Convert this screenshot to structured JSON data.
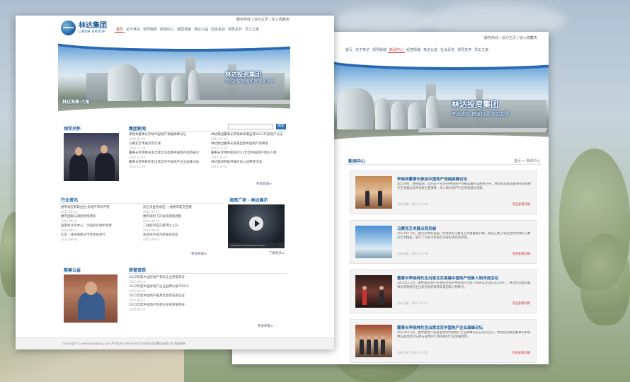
{
  "front": {
    "top_links": "服务热线 | 设为主页 | 加入收藏夹",
    "logo": {
      "cn": "林达集团",
      "en": "LINDA GROUP"
    },
    "nav": [
      "首页",
      "关于林达",
      "领导致辞",
      "新闻中心",
      "经营领域",
      "林达公益",
      "社会责任",
      "领导关怀",
      "员工之家"
    ],
    "banner": {
      "slogan": "林达投资集团",
      "sub": "开拓进取 把握机遇 领跑世界",
      "tag": "林达海景·六角"
    },
    "leader": {
      "title": "领导关怀"
    },
    "news": {
      "title": "集团新闻",
      "col1": [
        {
          "t": "李晓林董事长参加中国地产领袖高峰论坛",
          "d": "2013-01-09"
        },
        {
          "t": "马赛克艺术展点亮京城",
          "d": "2012-12-18"
        },
        {
          "t": "董事长李晓林先生出席北京高端中国地产创新研讨",
          "d": "2012-12-21"
        },
        {
          "t": "董事长李晓林先生出席北京中国地产企业高峰论坛",
          "d": "2012-12-20"
        }
      ],
      "col2": [
        {
          "t": "林达集团董事长李晓林受邀出席2012年度地产论坛",
          "d": "2012-12-04"
        },
        {
          "t": "林达集团董事长受邀出席中国地产高峰会",
          "d": "2012-12-07"
        },
        {
          "t": "董事长李晓林荣获2012年度中国地产领军人物",
          "d": "2012-11-21"
        },
        {
          "t": "林达集团积极开展社会公益慈善活动",
          "d": "2012-10-16"
        }
      ],
      "more": "更多新闻"
    },
    "industry": {
      "title": "行业资讯",
      "col1": [
        {
          "t": "楼市调控新政出台 房地产市场平稳",
          "d": "2012-09-16"
        },
        {
          "t": "楼市回暖与调控政策博弈",
          "d": "2012-09-14"
        },
        {
          "t": "国家统计局中心：全国房价稳中有降",
          "d": "2012-09-12"
        },
        {
          "t": "北京：住房保障与市场体系并行",
          "d": "2012-09-08"
        }
      ],
      "col2": [
        {
          "t": "房企资金链承压 一线楼市成交回暖",
          "d": "2012-09-11"
        },
        {
          "t": "楼市调控下开发商策略调整",
          "d": "2012-09-10"
        },
        {
          "t": "二线城市成交量环比上升",
          "d": "2012-09-06"
        },
        {
          "t": "商业地产成为开发商新宠",
          "d": "2012-09-03"
        }
      ],
      "more": "更多新闻"
    },
    "video": {
      "title": "海南广场 · 林达展示",
      "more": "了解更多"
    },
    "charity": {
      "title": "慈善公益"
    },
    "awards": {
      "title": "荣誉资质",
      "items": [
        {
          "t": "2012年度中国房地产领军企业荣誉称号",
          "d": "2011-08-13"
        },
        {
          "t": "2012年度中国房地产企业品牌价值TOP10",
          "d": "2012-08-09"
        },
        {
          "t": "2011年度中国地产最具社会责任感企业",
          "d": "2012-08-11"
        },
        {
          "t": "2011年度中国地产优秀企业家荣誉称号",
          "d": "2012-08-10"
        }
      ],
      "more": "更多荣誉"
    },
    "search": {
      "button": "搜索"
    },
    "footer": "Copyright © www.lindagroup.com All Rights Reserved 北京林达投资集团有限公司 版权所有"
  },
  "back": {
    "top_links": "服务热线 | 设为主页 | 加入收藏夹",
    "nav": [
      "首页",
      "关于林达",
      "领导致辞",
      "新闻中心",
      "经营领域",
      "林达公益",
      "社会责任",
      "领导关怀",
      "员工之家"
    ],
    "banner": {
      "slogan": "林达投资集团",
      "sub": "开拓进取 把握机遇 领跑世界"
    },
    "section_title": "新闻中心",
    "breadcrumb": "首页 > 新闻中心",
    "items": [
      {
        "title": "李晓林董事长参加中国地产领袖高峰论坛",
        "desc": "新年伊始，由搜狐网、焦点房产主办的中国地产领袖高峰论坛隆重召开，林达投资集团董事长李晓林先生受邀出席并发表主题演讲，深入探讨地产行业的发展与创新。",
        "date": "发布日期：2013-01-09",
        "more": "点击查看详情"
      },
      {
        "title": "马赛克艺术展点亮京城",
        "desc": "2012年12月，由北京林达海晨广场承办的马赛克艺术展隆重开幕，展览汇集了来自世界各地的马赛克艺术精品，吸引了众多市民和艺术爱好者前来参观。",
        "date": "发布日期：2012-12-18",
        "more": "点击查看详情"
      },
      {
        "title": "董事长李晓林先生出席北京高端中国地产创新人物评选活动",
        "desc": "2012年12月，由中国房地产业协会主办的中国地产创新人物评选活动在北京举行，林达投资集团董事长李晓林先生出席活动并荣获年度创新人物称号。",
        "date": "发布日期：2012-12-21",
        "more": "点击查看详情"
      },
      {
        "title": "董事长李晓林先生出席北京中国地产企业高峰论坛",
        "desc": "2012年12月，由中国地产商会主办的中国地产企业高峰论坛在北京召开，林达投资集团董事长李晓林先生出席论坛并与业界同仁共同探讨行业发展趋势。",
        "date": "发布日期：2012-12-20",
        "more": "点击查看详情"
      }
    ]
  }
}
